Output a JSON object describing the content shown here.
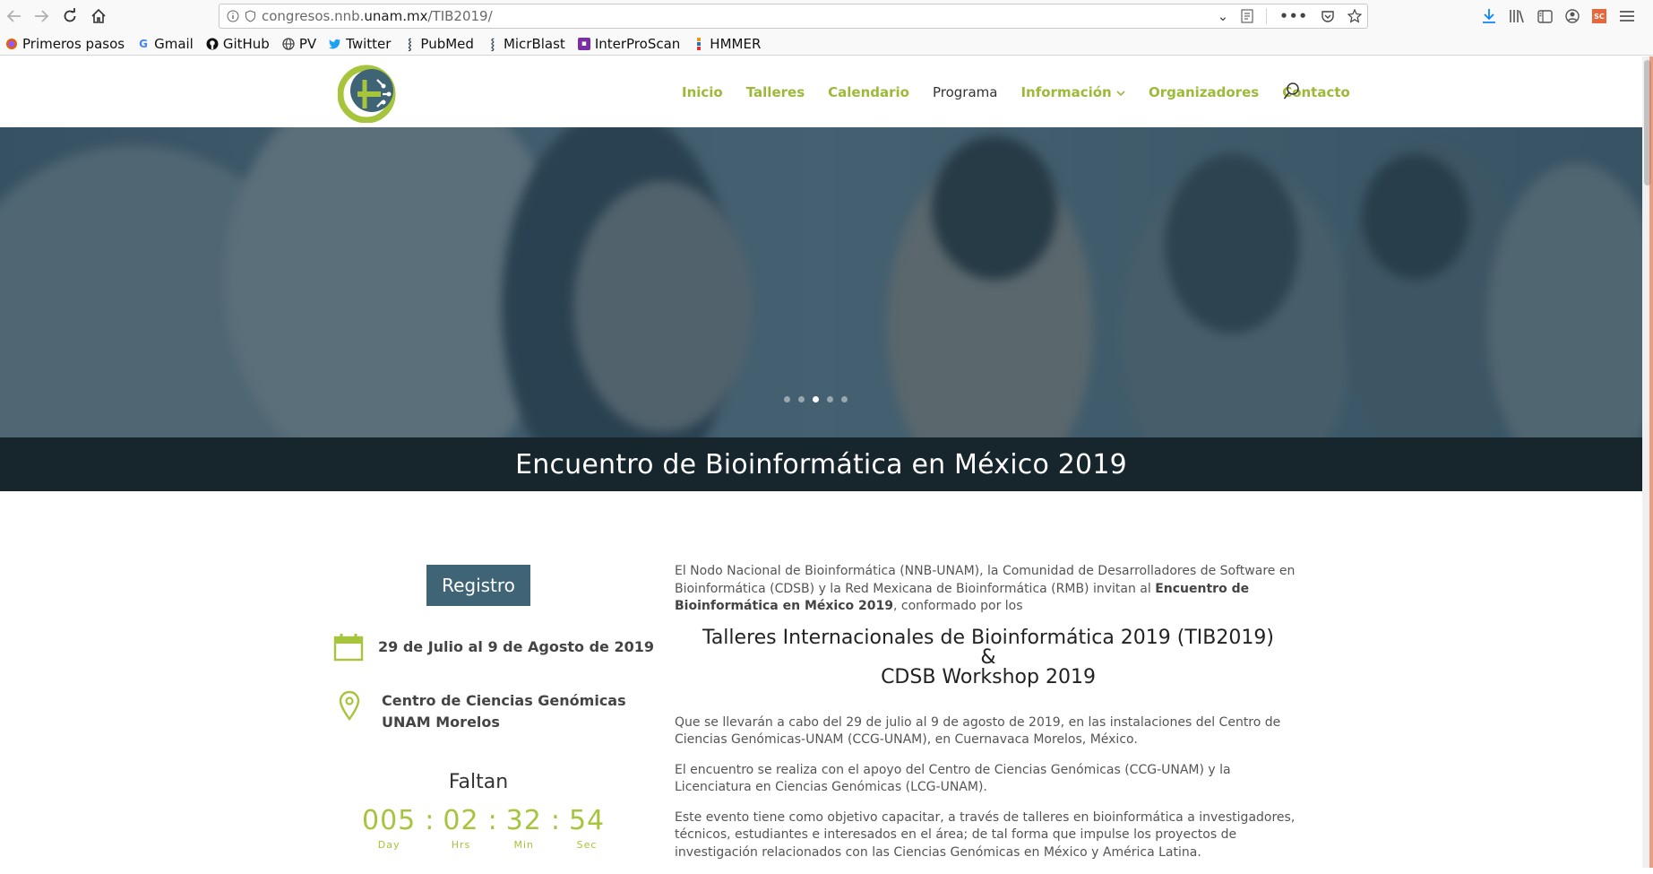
{
  "browser": {
    "url_prefix": "congresos.nnb.",
    "url_domain": "unam.mx",
    "url_path": "/TIB2019/",
    "bookmarks": [
      "Primeros pasos",
      "Gmail",
      "GitHub",
      "PV",
      "Twitter",
      "PubMed",
      "MicrBlast",
      "InterProScan",
      "HMMER"
    ]
  },
  "nav": {
    "items": [
      "Inicio",
      "Talleres",
      "Calendario",
      "Programa",
      "Información",
      "Organizadores",
      "Contacto"
    ],
    "active": "Programa"
  },
  "hero": {
    "slides": 5,
    "active_slide": 3,
    "title": "Encuentro de Bioinformática en México 2019"
  },
  "sidebar": {
    "register_label": "Registro",
    "dates": "29 de Julio al 9 de Agosto de 2019",
    "location_line1": "Centro de Ciencias Genómicas",
    "location_line2": "UNAM Morelos",
    "countdown_label": "Faltan",
    "countdown": {
      "days": "005",
      "hours": "02",
      "minutes": "32",
      "seconds": "54",
      "days_label": "Day",
      "hours_label": "Hrs",
      "minutes_label": "Min",
      "seconds_label": "Sec"
    }
  },
  "content": {
    "intro_start": "El Nodo Nacional de Bioinformática (NNB-UNAM), la Comunidad de Desarrolladores de Software en Bioinformática (CDSB) y la Red Mexicana de Bioinformática (RMB) invitan al ",
    "intro_bold": "Encuentro de Bioinformática en México 2019",
    "intro_end": ", conformado por los",
    "heading_line1": "Talleres Internacionales de Bioinformática 2019 (TIB2019)",
    "heading_amp": "&",
    "heading_line2": "CDSB Workshop 2019",
    "para1": "Que se llevarán a cabo del 29 de julio al 9 de agosto de 2019, en las instalaciones del Centro de Ciencias Genómicas-UNAM (CCG-UNAM), en Cuernavaca Morelos, México.",
    "para2": "El encuentro se realiza con el apoyo del Centro de Ciencias Genómicas (CCG-UNAM) y la Licenciatura en Ciencias Genómicas (LCG-UNAM).",
    "para3": "Este evento tiene como objetivo capacitar, a través de talleres en bioinformática a investigadores, técnicos, estudiantes e interesados en el área; de tal forma que impulse los proyectos de investigación relacionados con las Ciencias Genómicas en México y América Latina."
  },
  "colors": {
    "accent_green": "#9cb93a",
    "register_bg": "#3f6476",
    "title_band": "#17252d"
  }
}
